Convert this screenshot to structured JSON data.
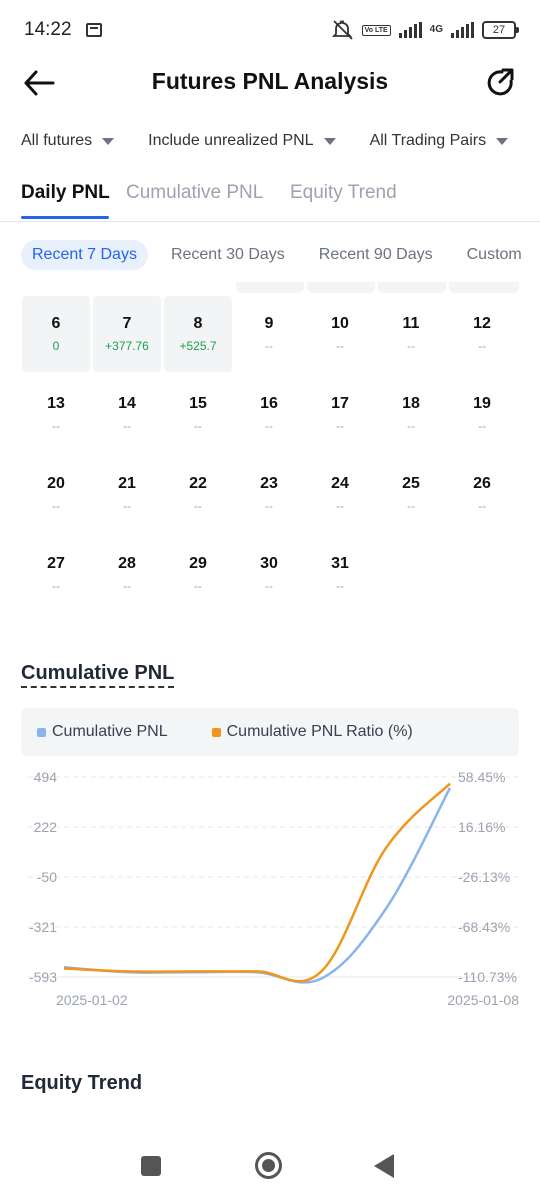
{
  "status_bar": {
    "time": "14:22",
    "network": "4G",
    "volte": "Vo LTE",
    "battery": "27"
  },
  "header": {
    "title": "Futures PNL Analysis",
    "back_icon": "arrow-left-icon",
    "share_icon": "share-icon"
  },
  "filters": [
    {
      "label": "All futures"
    },
    {
      "label": "Include unrealized PNL"
    },
    {
      "label": "All Trading Pairs"
    }
  ],
  "tabs": [
    {
      "label": "Daily PNL",
      "active": true
    },
    {
      "label": "Cumulative PNL",
      "active": false
    },
    {
      "label": "Equity Trend",
      "active": false
    }
  ],
  "ranges": [
    {
      "label": "Recent 7 Days",
      "active": true
    },
    {
      "label": "Recent 30 Days",
      "active": false
    },
    {
      "label": "Recent 90 Days",
      "active": false
    },
    {
      "label": "Custom",
      "active": false
    }
  ],
  "calendar": {
    "days": [
      {
        "day": "6",
        "pnl": "0",
        "active": true
      },
      {
        "day": "7",
        "pnl": "+377.76",
        "active": true
      },
      {
        "day": "8",
        "pnl": "+525.7",
        "active": true
      },
      {
        "day": "9",
        "pnl": "--"
      },
      {
        "day": "10",
        "pnl": "--"
      },
      {
        "day": "11",
        "pnl": "--"
      },
      {
        "day": "12",
        "pnl": "--"
      },
      {
        "day": "13",
        "pnl": "--"
      },
      {
        "day": "14",
        "pnl": "--"
      },
      {
        "day": "15",
        "pnl": "--"
      },
      {
        "day": "16",
        "pnl": "--"
      },
      {
        "day": "17",
        "pnl": "--"
      },
      {
        "day": "18",
        "pnl": "--"
      },
      {
        "day": "19",
        "pnl": "--"
      },
      {
        "day": "20",
        "pnl": "--"
      },
      {
        "day": "21",
        "pnl": "--"
      },
      {
        "day": "22",
        "pnl": "--"
      },
      {
        "day": "23",
        "pnl": "--"
      },
      {
        "day": "24",
        "pnl": "--"
      },
      {
        "day": "25",
        "pnl": "--"
      },
      {
        "day": "26",
        "pnl": "--"
      },
      {
        "day": "27",
        "pnl": "--"
      },
      {
        "day": "28",
        "pnl": "--"
      },
      {
        "day": "29",
        "pnl": "--"
      },
      {
        "day": "30",
        "pnl": "--"
      },
      {
        "day": "31",
        "pnl": "--"
      }
    ]
  },
  "cumulative_section": {
    "title": "Cumulative PNL"
  },
  "equity_section": {
    "title": "Equity Trend"
  },
  "colors": {
    "accent": "#2563eb",
    "positive": "#16a34a",
    "series_pnl": "#8ab4ec",
    "series_ratio": "#f0961c"
  },
  "chart_data": {
    "type": "line",
    "x": [
      "2025-01-02",
      "2025-01-03",
      "2025-01-04",
      "2025-01-05",
      "2025-01-06",
      "2025-01-07",
      "2025-01-08"
    ],
    "x_tick_labels": [
      "2025-01-02",
      "2025-01-08"
    ],
    "series": [
      {
        "name": "Cumulative PNL",
        "axis": "left",
        "color": "#8ab4ec",
        "values": [
          -540,
          -567,
          -567,
          -567,
          -601,
          -224,
          435
        ]
      },
      {
        "name": "Cumulative PNL Ratio (%)",
        "axis": "right",
        "color": "#f0961c",
        "values": [
          -103.5,
          -106.0,
          -106.0,
          -106.0,
          -106.0,
          -2.0,
          53.0
        ]
      }
    ],
    "y_left_ticks": [
      "494",
      "222",
      "-50",
      "-321",
      "-593"
    ],
    "y_right_ticks": [
      "58.45%",
      "16.16%",
      "-26.13%",
      "-68.43%",
      "-110.73%"
    ],
    "ylim_left": [
      -593,
      494
    ],
    "ylim_right": [
      -110.73,
      58.45
    ],
    "grid": true,
    "legend": "top"
  }
}
